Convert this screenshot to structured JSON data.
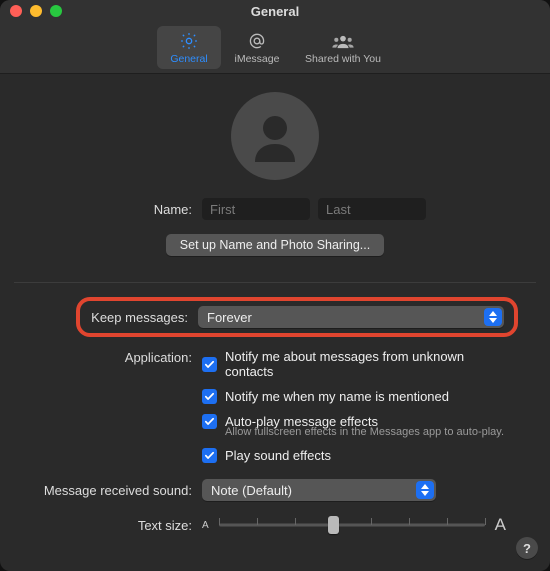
{
  "window": {
    "title": "General"
  },
  "toolbar": {
    "tabs": [
      {
        "label": "General"
      },
      {
        "label": "iMessage"
      },
      {
        "label": "Shared with You"
      }
    ]
  },
  "profile": {
    "name_label": "Name:",
    "first_placeholder": "First",
    "last_placeholder": "Last",
    "first_value": "",
    "last_value": "",
    "setup_button": "Set up Name and Photo Sharing..."
  },
  "keep_messages": {
    "label": "Keep messages:",
    "value": "Forever"
  },
  "application": {
    "label": "Application:",
    "items": [
      {
        "text": "Notify me about messages from unknown contacts"
      },
      {
        "text": "Notify me when my name is mentioned"
      },
      {
        "text": "Auto-play message effects",
        "subtext": "Allow fullscreen effects in the Messages app to auto-play."
      },
      {
        "text": "Play sound effects"
      }
    ]
  },
  "sound": {
    "label": "Message received sound:",
    "value": "Note (Default)"
  },
  "text_size": {
    "label": "Text size:",
    "small_glyph": "A",
    "big_glyph": "A",
    "ticks": 8,
    "position_pct": 43
  },
  "help": {
    "glyph": "?"
  }
}
